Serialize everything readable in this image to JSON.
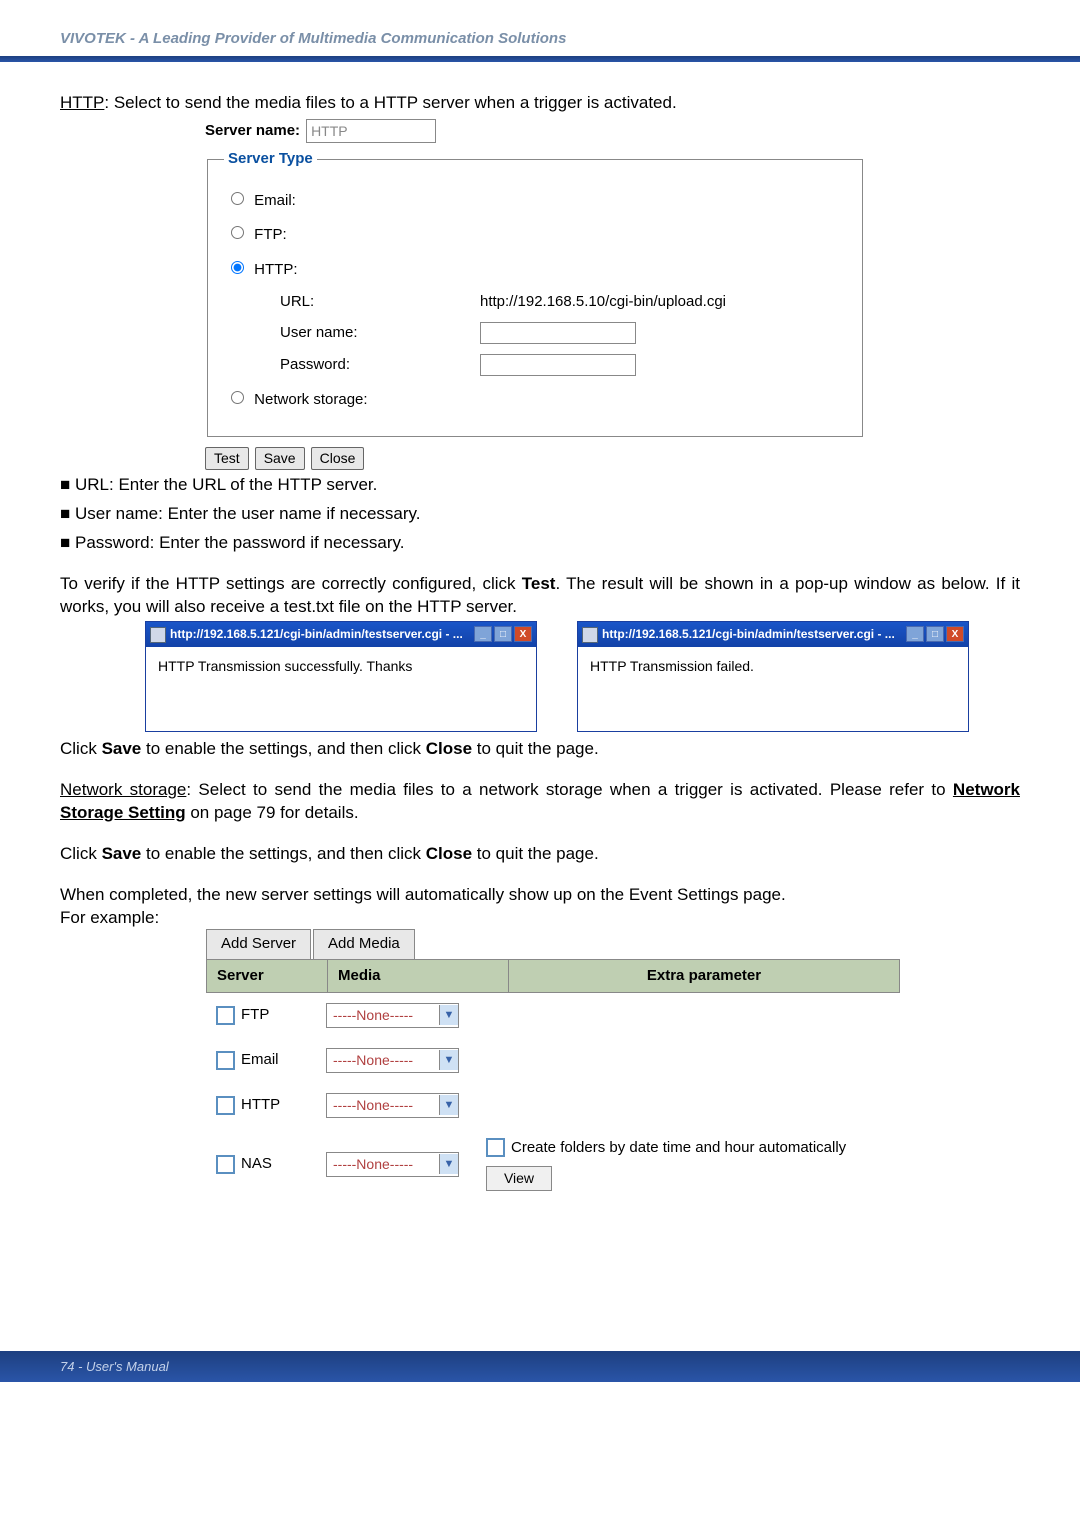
{
  "header": {
    "brand_text": "VIVOTEK - A Leading Provider of Multimedia Communication Solutions"
  },
  "http_section": {
    "intro_prefix": "HTTP",
    "intro_rest": ": Select to send the media files to a HTTP server when a trigger is activated.",
    "server_name_label": "Server name:",
    "server_name_value": "HTTP",
    "fieldset_legend": "Server Type",
    "radios": {
      "email": "Email:",
      "ftp": "FTP:",
      "http": "HTTP:",
      "network_storage": "Network storage:"
    },
    "url_label": "URL:",
    "url_value": "http://192.168.5.10/cgi-bin/upload.cgi",
    "username_label": "User name:",
    "password_label": "Password:",
    "buttons": {
      "test": "Test",
      "save": "Save",
      "close": "Close"
    },
    "bullets": {
      "url": "URL: Enter the URL of the HTTP server.",
      "username": "User name: Enter the user name if necessary.",
      "password": "Password: Enter the password if necessary."
    },
    "verify_text_1": "To verify if the HTTP settings are correctly configured, click ",
    "verify_test": "Test",
    "verify_text_2": ". The result will be shown in a pop-up window as below. If it works, you will also receive a test.txt file on the HTTP server."
  },
  "popups": {
    "title_left": "http://192.168.5.121/cgi-bin/admin/testserver.cgi - ...",
    "body_left": "HTTP Transmission successfully. Thanks",
    "title_right": "http://192.168.5.121/cgi-bin/admin/testserver.cgi - ...",
    "body_right": "HTTP Transmission failed."
  },
  "after_popups_1a": "Click ",
  "after_popups_1b": "Save",
  "after_popups_1c": " to enable the settings,  and then click ",
  "after_popups_1d": "Close",
  "after_popups_1e": " to quit the page.",
  "net_storage": {
    "label": "Network storage",
    "text_1": ": Select to send the media files to a network storage when a trigger is activated. Please refer to ",
    "link": "Network Storage Setting",
    "text_2": " on page 79 for details."
  },
  "save_close_again_a": "Click ",
  "save_close_again_b": "Save",
  "save_close_again_c": " to enable the settings,  and then click ",
  "save_close_again_d": "Close",
  "save_close_again_e": " to quit the page.",
  "completion_text": "When completed, the new server settings will automatically show up on the Event Settings page.",
  "for_example": "For example:",
  "event_table": {
    "tabs": {
      "add_server": "Add Server",
      "add_media": "Add Media"
    },
    "headers": {
      "server": "Server",
      "media": "Media",
      "extra": "Extra parameter"
    },
    "select_text": "-----None-----",
    "rows": {
      "ftp": "FTP",
      "email": "Email",
      "http": "HTTP",
      "nas": "NAS"
    },
    "nas_extra": {
      "create_folders": "Create folders by date time and hour automatically",
      "view": "View"
    }
  },
  "footer": "74 - User's Manual"
}
